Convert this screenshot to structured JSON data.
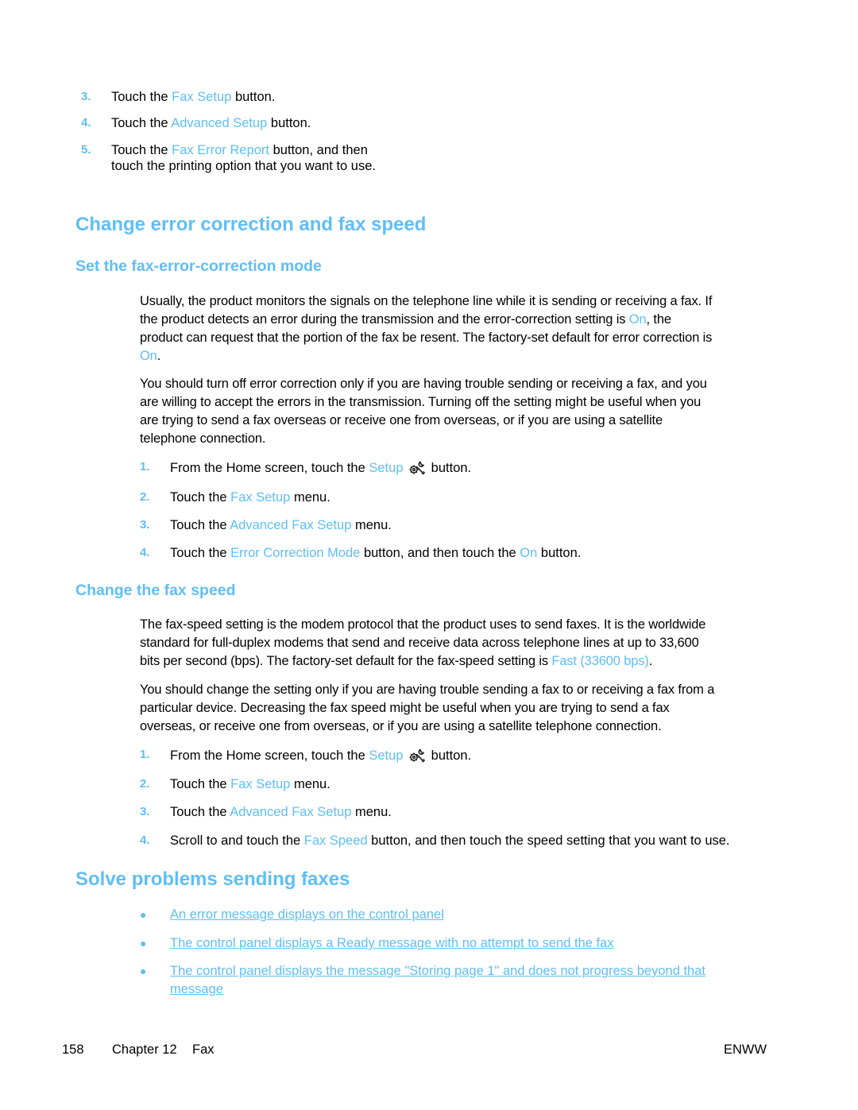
{
  "top_steps": [
    {
      "num": "3.",
      "pre": "Touch the ",
      "link": "Fax Setup",
      "post": " button."
    },
    {
      "num": "4.",
      "pre": "Touch the ",
      "link": "Advanced Setup",
      "post": " button."
    },
    {
      "num": "5.",
      "pre": "Touch the ",
      "link": "Fax Error Report",
      "post": " button, and then",
      "line2": "touch the printing option that you want to use."
    }
  ],
  "section1": {
    "title": "Change error correction and fax speed",
    "sub1": {
      "title": "Set the fax-error-correction mode",
      "para1": {
        "l1": "Usually, the product monitors the signals on the telephone line while it is sending or receiving a fax. If",
        "l2_pre": "the product detects an error during the transmission and the error-correction setting is ",
        "l2_link": "On",
        "l2_post": ", the",
        "l3": "product can request that the portion of the fax be resent. The factory-set default for error correction is",
        "l4_link": "On",
        "l4_post": "."
      },
      "para2": [
        "You should turn off error correction only if you are having trouble sending or receiving a fax, and you",
        "are willing to accept the errors in the transmission. Turning off the setting might be useful when you",
        "are trying to send a fax overseas or receive one from overseas, or if you are using a satellite",
        "telephone connection."
      ],
      "steps": [
        {
          "num": "1.",
          "pre": "From the Home screen, touch the ",
          "link": "Setup",
          "icon": "setup-icon",
          "post": " button."
        },
        {
          "num": "2.",
          "pre": "Touch the ",
          "link": "Fax Setup",
          "post": " menu."
        },
        {
          "num": "3.",
          "pre": "Touch the ",
          "link": "Advanced Fax Setup",
          "post": " menu."
        },
        {
          "num": "4.",
          "pre": "Touch the ",
          "link": "Error Correction Mode",
          "mid": " button, and then touch the ",
          "link2": "On",
          "post": " button."
        }
      ]
    },
    "sub2": {
      "title": "Change the fax speed",
      "para1": {
        "l1": "The fax-speed setting is the modem protocol that the product uses to send faxes. It is the worldwide",
        "l2": "standard for full-duplex modems that send and receive data across telephone lines at up to 33,600",
        "l3_pre": "bits per second (bps). The factory-set default for the fax-speed setting is ",
        "l3_link": "Fast (33600 bps)",
        "l3_post": "."
      },
      "para2": [
        "You should change the setting only if you are having trouble sending a fax to or receiving a fax from a",
        "particular device. Decreasing the fax speed might be useful when you are trying to send a fax",
        "overseas, or receive one from overseas, or if you are using a satellite telephone connection."
      ],
      "steps": [
        {
          "num": "1.",
          "pre": "From the Home screen, touch the ",
          "link": "Setup",
          "icon": "setup-icon",
          "post": " button."
        },
        {
          "num": "2.",
          "pre": "Touch the ",
          "link": "Fax Setup",
          "post": " menu."
        },
        {
          "num": "3.",
          "pre": "Touch the ",
          "link": "Advanced Fax Setup",
          "post": " menu."
        },
        {
          "num": "4.",
          "pre": "Scroll to and touch the ",
          "link": "Fax Speed",
          "post": " button, and then touch the speed setting that you want to use."
        }
      ]
    }
  },
  "section2": {
    "title": "Solve problems sending faxes",
    "links": [
      {
        "line1": "An error message displays on the control panel"
      },
      {
        "line1": "The control panel displays a Ready message with no attempt to send the fax"
      },
      {
        "line1": "The control panel displays the message \"Storing page 1\" and does not progress beyond that",
        "line2": "message"
      }
    ]
  },
  "footer": {
    "page_number": "158",
    "chapter": "Chapter 12",
    "chapter_title": "Fax",
    "right": "ENWW"
  },
  "colors": {
    "accent": "#5fbef5",
    "text": "#000000"
  }
}
